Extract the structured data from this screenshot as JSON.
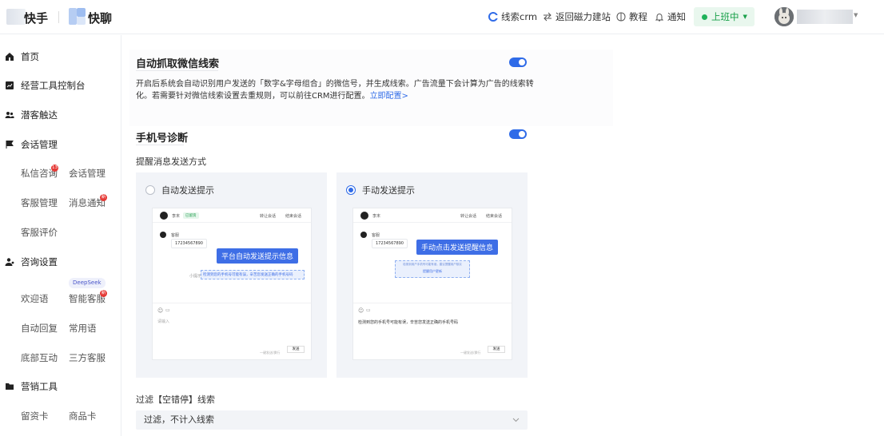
{
  "topbar": {
    "brand_kuaishou": "快手",
    "brand_kuailiao": "快聊",
    "nav": [
      {
        "label": "线索crm",
        "icon": "crm-logo-icon"
      },
      {
        "label": "返回磁力建站",
        "icon": "swap-arrows-icon"
      },
      {
        "label": "教程",
        "icon": "tutorial-icon"
      },
      {
        "label": "通知",
        "icon": "bell-icon"
      }
    ],
    "status_label": "上班中",
    "colors": {
      "accent": "#2f6be8",
      "status_green": "#1fb25a"
    }
  },
  "sidebar": {
    "home": "首页",
    "console": "经营工具控制台",
    "prospect": "潜客触达",
    "session_mgmt": "会话管理",
    "sub_private_msg": "私信咨询",
    "sub_private_msg_badge": "13",
    "sub_session": "会话管理",
    "sub_cs_mgmt": "客服管理",
    "sub_msg_notify": "消息通知",
    "sub_msg_notify_badge": "新",
    "sub_cs_eval": "客服评价",
    "consult_settings": "咨询设置",
    "deepseek_tag": "DeepSeek",
    "sub_welcome": "欢迎语",
    "sub_ai_cs": "智能客服",
    "sub_ai_cs_badge": "新",
    "sub_auto_reply": "自动回复",
    "sub_common_phrases": "常用语",
    "sub_bottom_interact": "底部互动",
    "sub_third_cs": "三方客服",
    "marketing_tools": "营销工具",
    "sub_lead_card": "留资卡",
    "sub_product_card": "商品卡"
  },
  "wechat_section": {
    "title": "自动抓取微信线索",
    "enabled": true,
    "description": "开启后系统会自动识别用户发送的「数字&字母组合」的微信号，并生成线索。广告流量下会计算为广告的线索转化。若需要针对微信线索设置去重规则，可以前往CRM进行配置。",
    "link": "立即配置>"
  },
  "phone_section": {
    "title": "手机号诊断",
    "enabled": true,
    "reminder_label": "提醒消息发送方式",
    "options": [
      {
        "label": "自动发送提示",
        "selected": false,
        "mock": {
          "user": "李末",
          "tag": "已留资",
          "action1": "转让会话",
          "action2": "结束会话",
          "bubble_label": "客服",
          "phone": "17234567890",
          "callout": "平台自动发送提示信息",
          "hint_prefix": "小提示",
          "hint": "检测到您的手机号可能有误，辛苦您发送正确的手机号码",
          "input_placeholder": "请输入",
          "send_hint": "一键发送/换行",
          "send": "发送"
        }
      },
      {
        "label": "手动发送提示",
        "selected": true,
        "mock": {
          "user": "李末",
          "action1": "转让会话",
          "action2": "结束会话",
          "bubble_label": "客服",
          "phone": "17234567890",
          "callout": "手动点击发送提醒信息",
          "hint_line1": "检测到用户手机号可能有误，建议提醒用户核实",
          "hint_line2": "提醒用户更新",
          "input_hint": "检测到您的手机号可能有误，辛苦您发送正确的手机号码",
          "send_hint": "一键发送/换行",
          "send": "发送"
        }
      }
    ]
  },
  "filter": {
    "label": "过滤【空错停】线索",
    "selected": "过滤，不计入线索"
  }
}
